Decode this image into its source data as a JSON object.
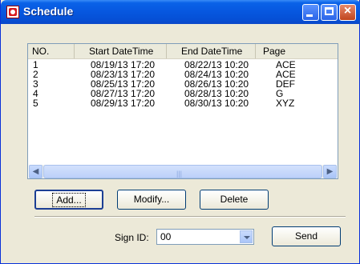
{
  "window": {
    "title": "Schedule"
  },
  "list": {
    "columns": [
      "NO.",
      "Start DateTime",
      "End DateTime",
      "Page"
    ],
    "rows": [
      [
        "1",
        "08/19/13 17:20",
        "08/22/13 10:20",
        "ACE"
      ],
      [
        "2",
        "08/23/13 17:20",
        "08/24/13 10:20",
        "ACE"
      ],
      [
        "3",
        "08/25/13 17:20",
        "08/26/13 10:20",
        "DEF"
      ],
      [
        "4",
        "08/27/13 17:20",
        "08/28/13 10:20",
        "G"
      ],
      [
        "5",
        "08/29/13 17:20",
        "08/30/13 10:20",
        "XYZ"
      ]
    ]
  },
  "buttons": {
    "add": "Add...",
    "modify": "Modify...",
    "delete": "Delete",
    "send": "Send"
  },
  "sign_id": {
    "label": "Sign ID:",
    "value": "00"
  }
}
